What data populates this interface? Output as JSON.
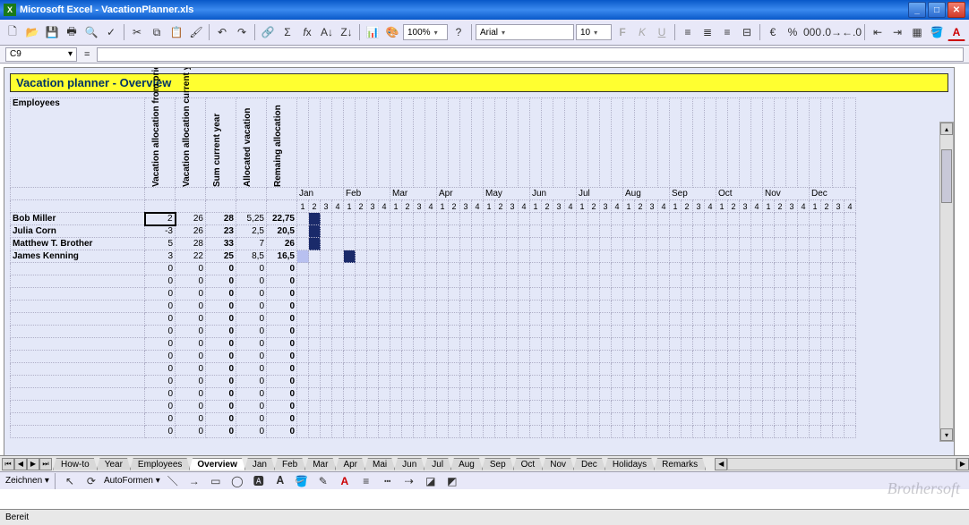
{
  "window": {
    "title": "Microsoft Excel - VacationPlanner.xls"
  },
  "toolbar": {
    "zoom": "100%",
    "font": "Arial",
    "font_size": "10"
  },
  "formula": {
    "cell_ref": "C9",
    "value": ""
  },
  "banner": "Vacation planner - Overview",
  "headers": {
    "employees": "Employees",
    "cols": [
      "Vacation allocation from prior year",
      "Vacation allocation current year",
      "Sum current year",
      "Allocated vacation",
      "Remaing allocation"
    ]
  },
  "months": [
    "Jan",
    "Feb",
    "Mar",
    "Apr",
    "May",
    "Jun",
    "Jul",
    "Aug",
    "Sep",
    "Oct",
    "Nov",
    "Dec"
  ],
  "weeks": [
    "1",
    "2",
    "3",
    "4"
  ],
  "rows": [
    {
      "name": "Bob Miller",
      "v": [
        "2",
        "26",
        "28",
        "5,25",
        "22,75"
      ],
      "fill": [
        2
      ]
    },
    {
      "name": "Julia Corn",
      "v": [
        "-3",
        "26",
        "23",
        "2,5",
        "20,5"
      ],
      "fill": [
        2
      ]
    },
    {
      "name": "Matthew T. Brother",
      "v": [
        "5",
        "28",
        "33",
        "7",
        "26"
      ],
      "fill": [
        2
      ]
    },
    {
      "name": "James Kenning",
      "v": [
        "3",
        "22",
        "25",
        "8,5",
        "16,5"
      ],
      "fill": [
        1,
        5
      ],
      "light": [
        1
      ]
    },
    {
      "name": "",
      "v": [
        "0",
        "0",
        "0",
        "0",
        "0"
      ]
    },
    {
      "name": "",
      "v": [
        "0",
        "0",
        "0",
        "0",
        "0"
      ]
    },
    {
      "name": "",
      "v": [
        "0",
        "0",
        "0",
        "0",
        "0"
      ]
    },
    {
      "name": "",
      "v": [
        "0",
        "0",
        "0",
        "0",
        "0"
      ]
    },
    {
      "name": "",
      "v": [
        "0",
        "0",
        "0",
        "0",
        "0"
      ]
    },
    {
      "name": "",
      "v": [
        "0",
        "0",
        "0",
        "0",
        "0"
      ]
    },
    {
      "name": "",
      "v": [
        "0",
        "0",
        "0",
        "0",
        "0"
      ]
    },
    {
      "name": "",
      "v": [
        "0",
        "0",
        "0",
        "0",
        "0"
      ]
    },
    {
      "name": "",
      "v": [
        "0",
        "0",
        "0",
        "0",
        "0"
      ]
    },
    {
      "name": "",
      "v": [
        "0",
        "0",
        "0",
        "0",
        "0"
      ]
    },
    {
      "name": "",
      "v": [
        "0",
        "0",
        "0",
        "0",
        "0"
      ]
    },
    {
      "name": "",
      "v": [
        "0",
        "0",
        "0",
        "0",
        "0"
      ]
    },
    {
      "name": "",
      "v": [
        "0",
        "0",
        "0",
        "0",
        "0"
      ]
    },
    {
      "name": "",
      "v": [
        "0",
        "0",
        "0",
        "0",
        "0"
      ]
    }
  ],
  "tabs": [
    "How-to",
    "Year",
    "Employees",
    "Overview",
    "Jan",
    "Feb",
    "Mar",
    "Apr",
    "Mai",
    "Jun",
    "Jul",
    "Aug",
    "Sep",
    "Oct",
    "Nov",
    "Dec",
    "Holidays",
    "Remarks"
  ],
  "active_tab": "Overview",
  "draw": {
    "label": "Zeichnen",
    "autoshapes": "AutoFormen"
  },
  "status": "Bereit",
  "watermark": "Brothersoft"
}
